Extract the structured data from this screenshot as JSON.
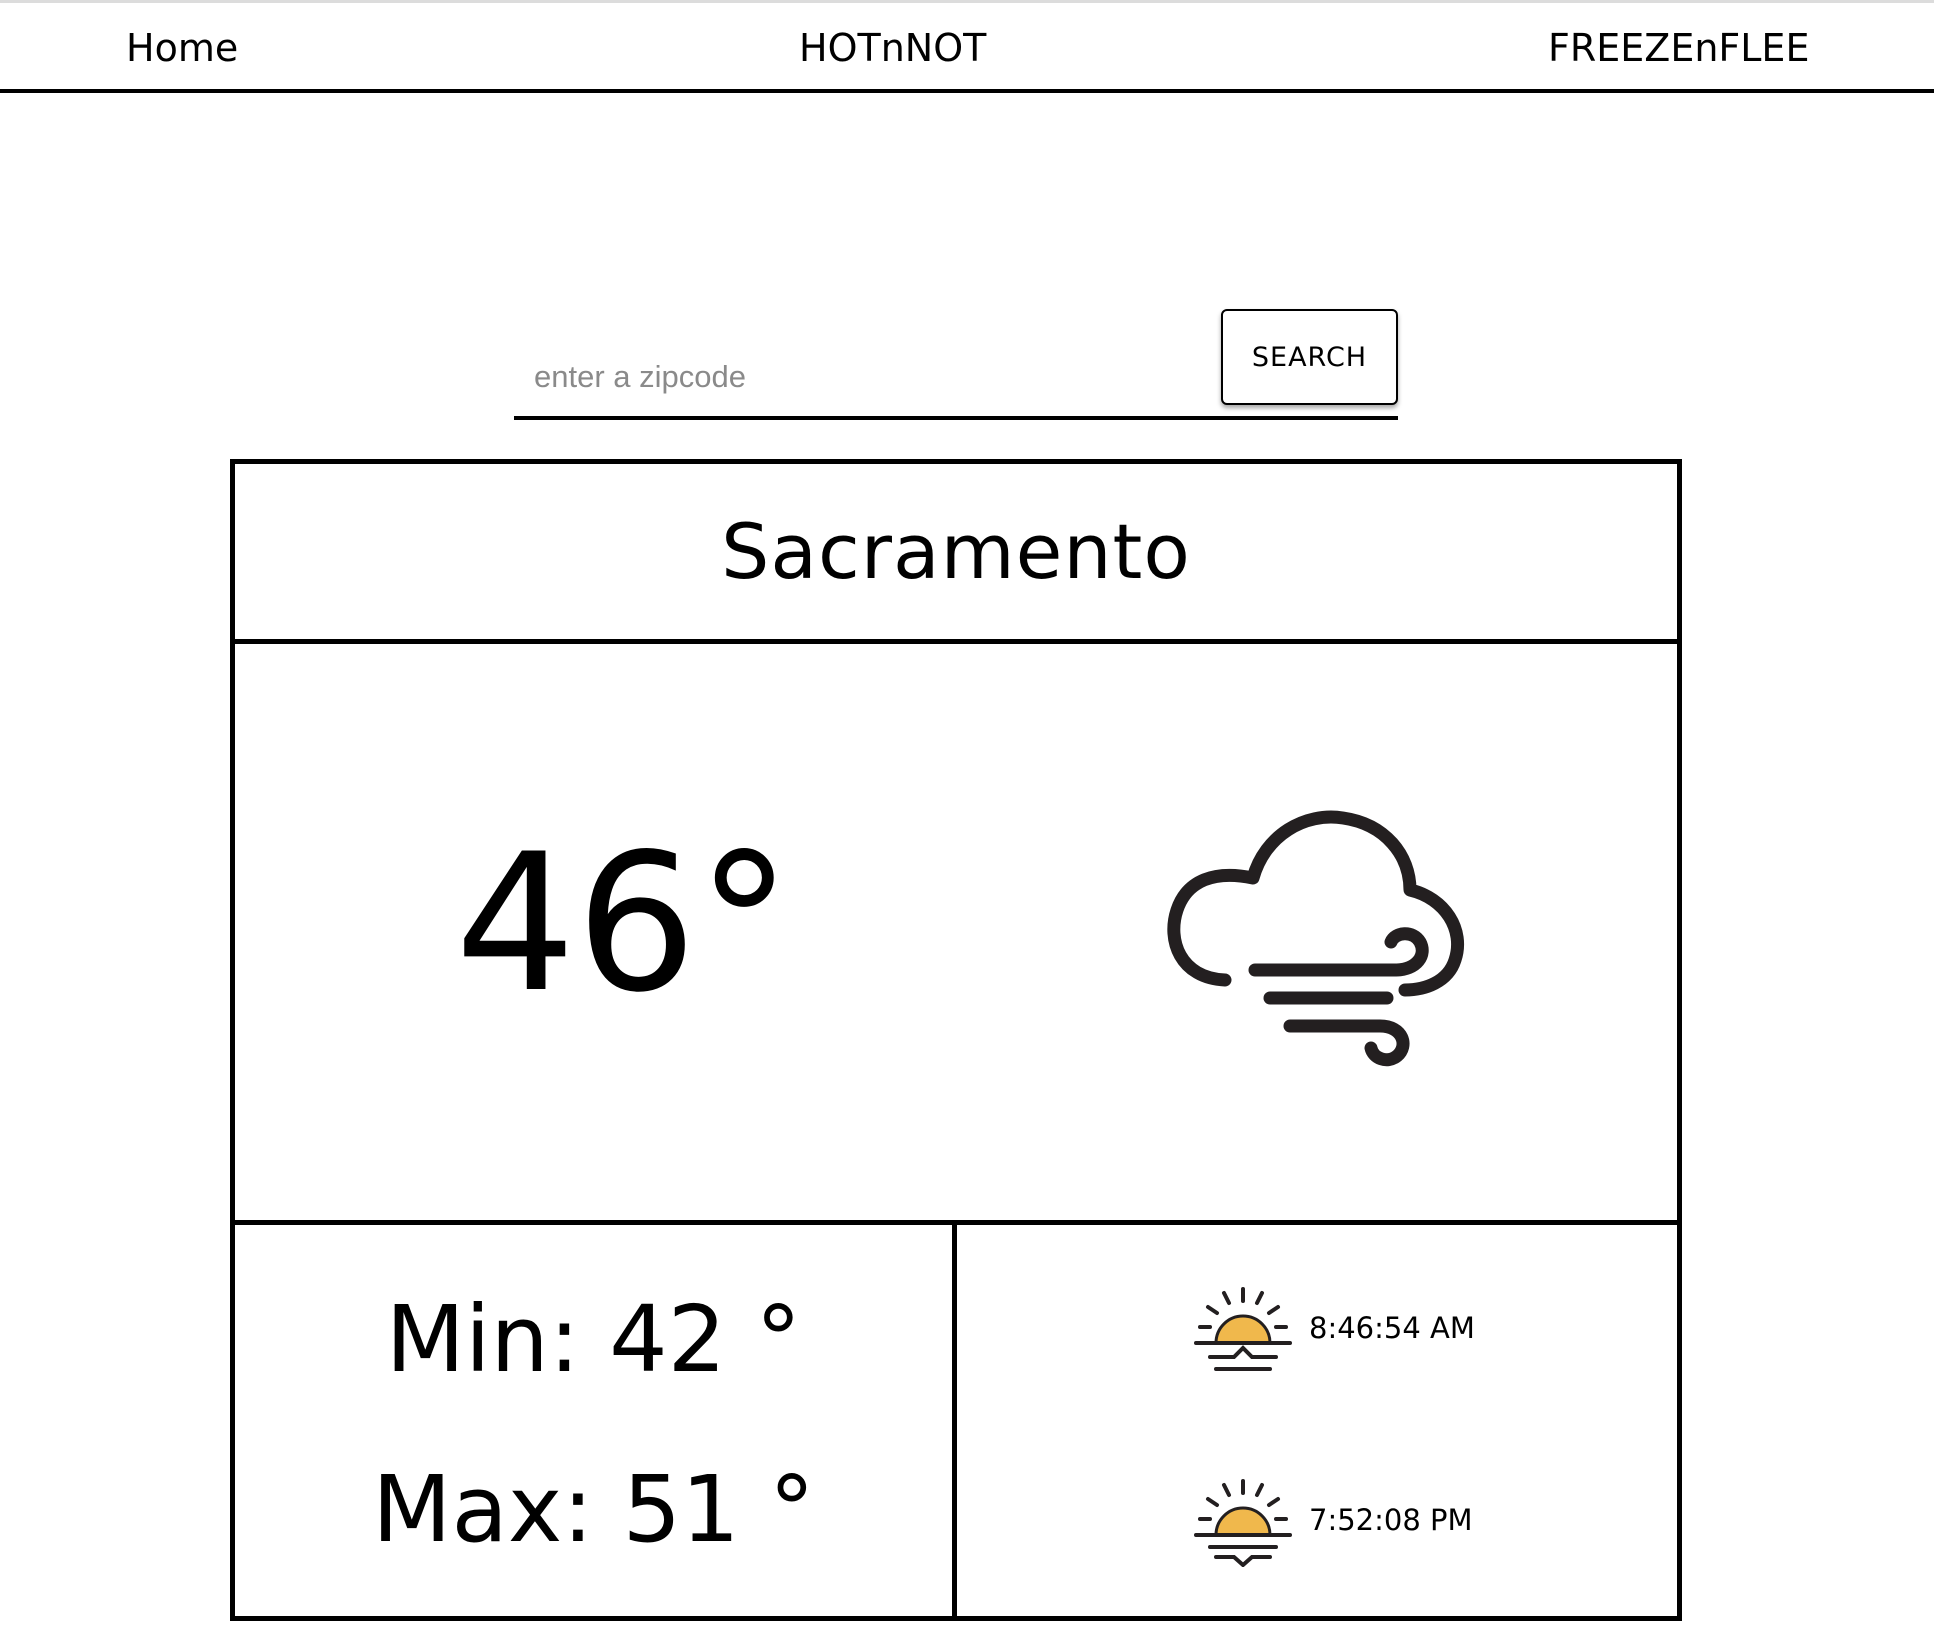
{
  "nav": {
    "home_label": "Home",
    "hot_label": "HOTnNOT",
    "freeze_label": "FREEZEnFLEE"
  },
  "search": {
    "placeholder": "enter a zipcode",
    "value": "",
    "button_label": "SEARCH"
  },
  "weather": {
    "city": "Sacramento",
    "current_temp": "46°",
    "condition_icon": "windy-cloud-icon",
    "min_label": "Min: 42 °",
    "max_label": "Max: 51 °",
    "sunrise": {
      "icon": "sunrise-icon",
      "time": "8:46:54 AM"
    },
    "sunset": {
      "icon": "sunset-icon",
      "time": "7:52:08 PM"
    }
  },
  "colors": {
    "border": "#000000",
    "icon_stroke": "#231f20",
    "sun_fill": "#f0b84c",
    "placeholder": "#8a8a8a",
    "nav_top_border": "#dcdcdc"
  }
}
